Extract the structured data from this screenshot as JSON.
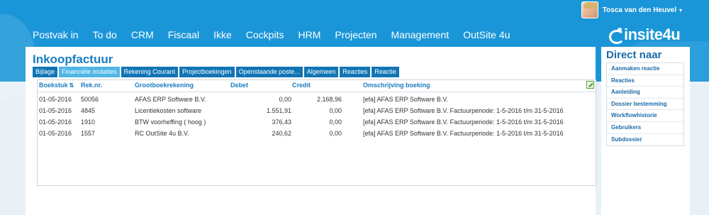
{
  "user": {
    "name": "Tosca van den Heuvel"
  },
  "nav": {
    "items": [
      "Postvak in",
      "To do",
      "CRM",
      "Fiscaal",
      "Ikke",
      "Cockpits",
      "HRM",
      "Projecten",
      "Management",
      "OutSite 4u"
    ]
  },
  "logo": {
    "text": "insite4u"
  },
  "page": {
    "title": "Inkoopfactuur"
  },
  "tabs": {
    "items": [
      "Bijlage",
      "Financiële mutaties",
      "Rekening Courant",
      "Projectboekingen",
      "Openstaande poste...",
      "Algemeen",
      "Reacties",
      "Reactie"
    ],
    "active": "Financiële mutaties"
  },
  "grid": {
    "headers": {
      "boekstuk": "Boekstuk",
      "reknr": "Rek.nr.",
      "grootboek": "Grootboekrekening",
      "debet": "Debet",
      "credit": "Credit",
      "omschrijving": "Omschrijving boeking"
    },
    "rows": [
      {
        "date": "01-05-2016",
        "reknr": "50056",
        "grootboek": "AFAS ERP Software B.V.",
        "debet": "0,00",
        "credit": "2.168,96",
        "omschrijving": "[efa] AFAS ERP Software B.V."
      },
      {
        "date": "01-05-2016",
        "reknr": "4845",
        "grootboek": "Licentiekosten software",
        "debet": "1.551,91",
        "credit": "0,00",
        "omschrijving": "[efa] AFAS ERP Software B.V. Factuurperiode: 1-5-2016 t/m 31-5-2016"
      },
      {
        "date": "01-05-2016",
        "reknr": "1910",
        "grootboek": "BTW voorheffing ( hoog )",
        "debet": "376,43",
        "credit": "0,00",
        "omschrijving": "[efa] AFAS ERP Software B.V. Factuurperiode: 1-5-2016 t/m 31-5-2016"
      },
      {
        "date": "01-05-2016",
        "reknr": "1557",
        "grootboek": "RC OutSite 4u B.V.",
        "debet": "240,62",
        "credit": "0,00",
        "omschrijving": "[efa] AFAS ERP Software B.V. Factuurperiode: 1-5-2016 t/m 31-5-2016"
      }
    ]
  },
  "direct": {
    "title": "Direct naar",
    "items": [
      "Aanmaken reactie",
      "Reacties",
      "Aanleiding",
      "Dossier bestemming",
      "Workflowhistorie",
      "Gebruikers",
      "Subdossier"
    ]
  },
  "colors": {
    "brand_blue": "#1a96d8",
    "tab_blue": "#1175b5",
    "tab_active": "#4fb6e6",
    "link_blue": "#1a7dc0"
  },
  "icons": {
    "sort": "sort-arrows-icon",
    "edit": "edit-icon",
    "caret": "caret-down-icon"
  }
}
